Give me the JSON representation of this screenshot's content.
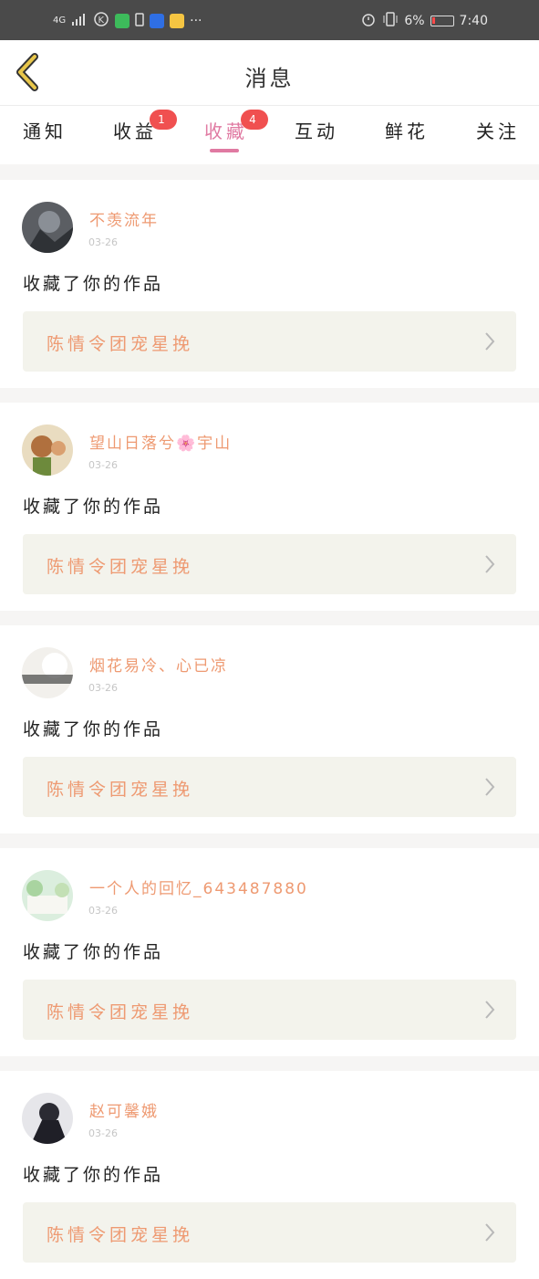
{
  "status_bar": {
    "network": "4G",
    "battery_text": "6%",
    "time": "7:40",
    "dots": "···"
  },
  "header": {
    "title": "消息",
    "back_icon": "chevron-left-icon",
    "accent": "#e07aa2",
    "back_color": "#c9a12b"
  },
  "tabs": [
    {
      "label": "通知"
    },
    {
      "label": "收益",
      "badge": "1"
    },
    {
      "label": "收藏",
      "badge": "4",
      "active": true
    },
    {
      "label": "互动"
    },
    {
      "label": "鲜花"
    },
    {
      "label": "关注"
    }
  ],
  "messages": [
    {
      "user": "不羡流年",
      "date": "03-26",
      "action": "收藏了你的作品",
      "work": "陈情令团宠星挽"
    },
    {
      "user": "望山日落兮🌸宇山",
      "date": "03-26",
      "action": "收藏了你的作品",
      "work": "陈情令团宠星挽"
    },
    {
      "user": "烟花易冷、心已凉",
      "date": "03-26",
      "action": "收藏了你的作品",
      "work": "陈情令团宠星挽"
    },
    {
      "user": "一个人的回忆_643487880",
      "date": "03-26",
      "action": "收藏了你的作品",
      "work": "陈情令团宠星挽"
    },
    {
      "user": "赵可馨娥",
      "date": "03-26",
      "action": "收藏了你的作品",
      "work": "陈情令团宠星挽"
    }
  ]
}
